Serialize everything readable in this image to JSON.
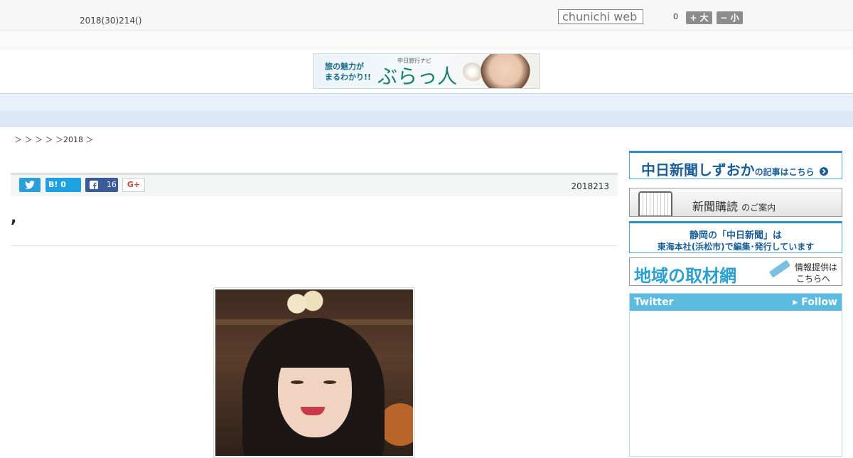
{
  "header": {
    "date": "2018(30)214()",
    "search_placeholder": "chunichi web",
    "count": "0",
    "font_larger": "+ 大",
    "font_smaller": "− 小"
  },
  "banner": {
    "line1": "旅の魅力が",
    "line2": "まるわかり!!",
    "small": "中日旅行ナビ",
    "main": "ぶらっ人"
  },
  "nav": {
    "items": [
      "    ",
      "    ",
      "    ",
      "    ",
      "    ",
      "    ",
      "    ",
      "    ",
      "    "
    ]
  },
  "breadcrumb": "＞ ＞ ＞ ＞ ＞2018 ＞",
  "share": {
    "hatena_label": "B!",
    "hatena_count": "0",
    "facebook_count": "16",
    "gplus_label": "G+"
  },
  "article": {
    "date": "2018213",
    "headline": ","
  },
  "sidebar": {
    "shizuoka_main": "中日新聞しずおか",
    "shizuoka_tail": "の記事はこちら",
    "subscribe_main": "新聞購読",
    "subscribe_tail": "のご案内",
    "tokai_line1": "静岡の「中日新聞」は",
    "tokai_line2": "東海本社(浜松市)で編集･発行しています",
    "network_main": "地域の取材網",
    "network_r1": "情報提供は",
    "network_r2": "こちらへ",
    "twitter_label": "Twitter",
    "follow_label": "▸ Follow"
  },
  "colors": {
    "nav_bg": "#e8f1f9",
    "accent_blue": "#1c5e96",
    "twitter_bar": "#5bbce0"
  }
}
